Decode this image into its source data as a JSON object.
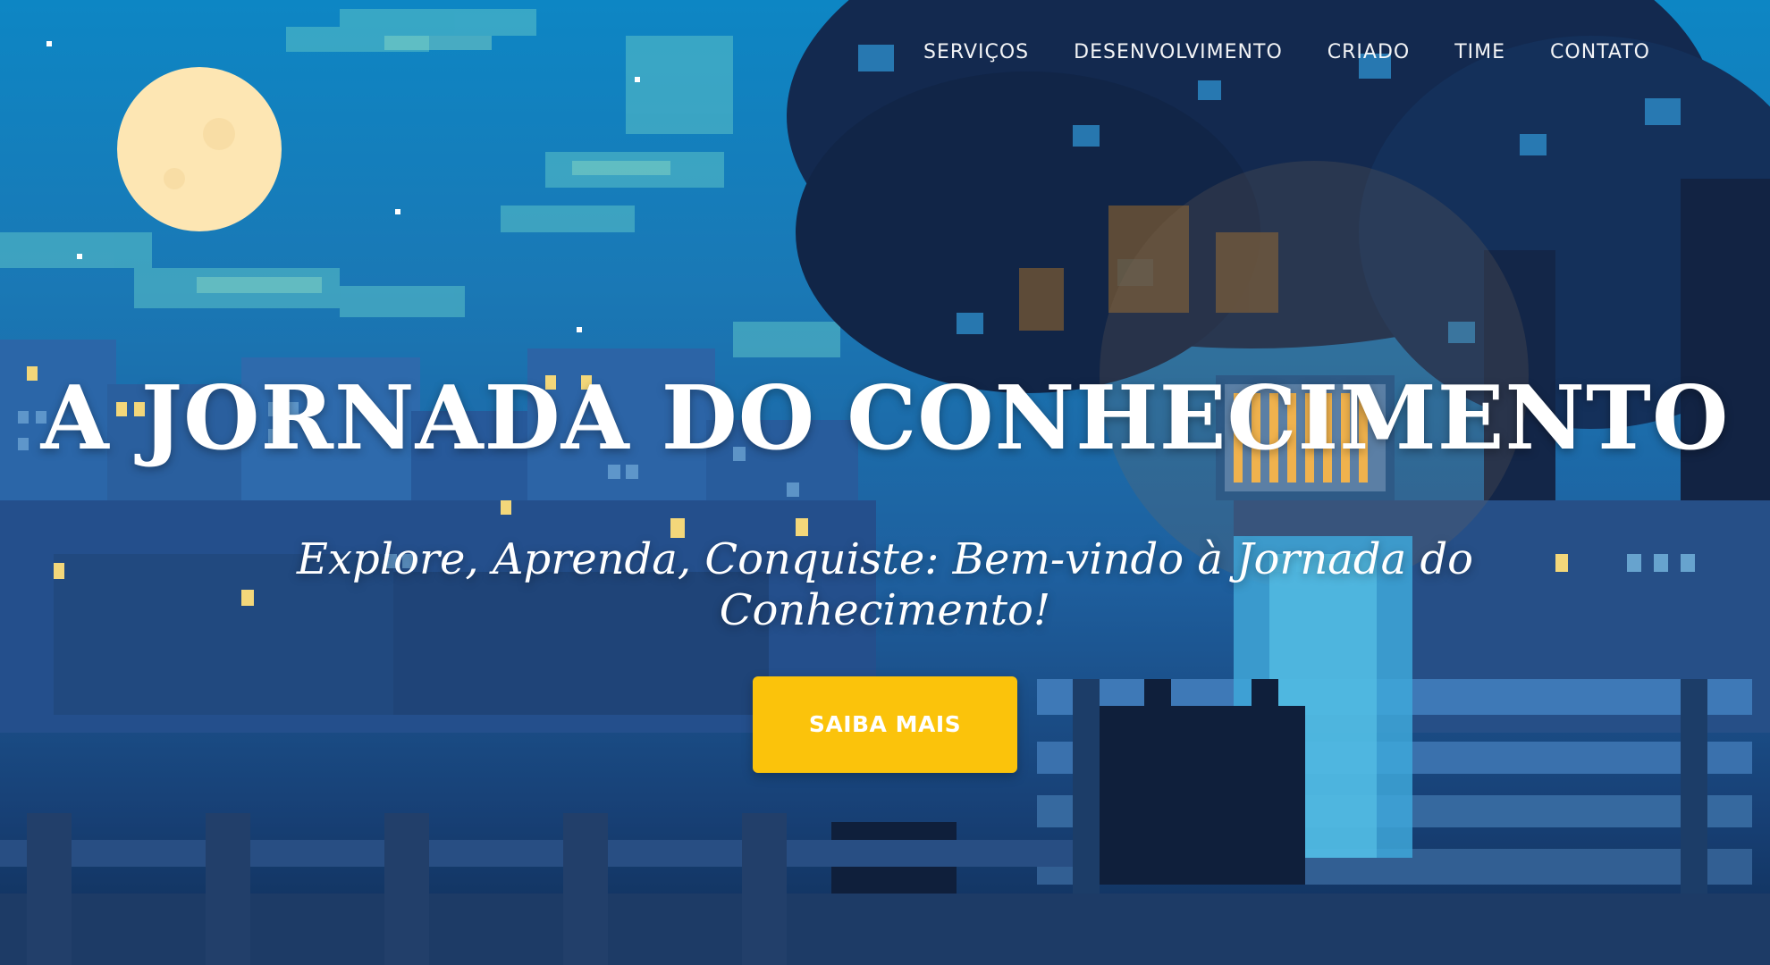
{
  "nav": {
    "items": [
      {
        "label": "SERVIÇOS"
      },
      {
        "label": "DESENVOLVIMENTO"
      },
      {
        "label": "CRIADO"
      },
      {
        "label": "TIME"
      },
      {
        "label": "CONTATO"
      }
    ]
  },
  "hero": {
    "title": "A JORNADA DO CONHECIMENTO",
    "subtitle": "Explore, Aprenda, Conquiste: Bem-vindo à Jornada do Conhecimento!",
    "cta_label": "SAIBA MAIS"
  },
  "colors": {
    "accent": "#fbc30b",
    "sky": "#0d86c4",
    "night_blue": "#173f74"
  },
  "illustration": {
    "icons": [
      "moon",
      "stars",
      "clouds",
      "city-skyline",
      "tree",
      "bench",
      "cat",
      "person-reading-book"
    ]
  }
}
